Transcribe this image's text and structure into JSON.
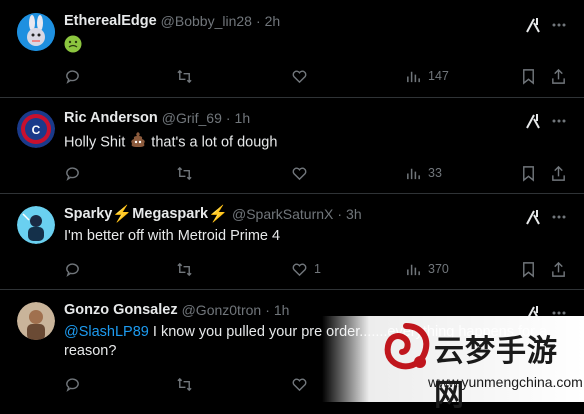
{
  "tweets": [
    {
      "name": "EtherealEdge",
      "handle": "@Bobby_lin28",
      "dot": "·",
      "time": "2h",
      "text": "",
      "emoji": "nauseated-face",
      "reply": "",
      "retweet": "",
      "like": "",
      "views": "147"
    },
    {
      "name": "Ric Anderson",
      "handle": "@Grif_69",
      "dot": "·",
      "time": "1h",
      "text_before": "Holly Shit ",
      "text_after": " that's a lot of dough",
      "emoji": "pile-of-poo",
      "reply": "",
      "retweet": "",
      "like": "",
      "views": "33"
    },
    {
      "name_part1": "Sparky ",
      "bolt": "⚡",
      "name_part2": "Megaspark",
      "handle": "@SparkSaturnX",
      "dot": "·",
      "time": "3h",
      "text": "I'm better off with Metroid Prime 4",
      "reply": "",
      "retweet": "",
      "like": "1",
      "views": "370"
    },
    {
      "name": "Gonzo Gonsalez",
      "handle": "@Gonz0tron",
      "dot": "·",
      "time": "1h",
      "mention": "@SlashLP89",
      "text": " I know you pulled your pre order.......everything happens for a reason?",
      "reply": "",
      "retweet": "",
      "like": "",
      "views": ""
    }
  ],
  "watermark": {
    "cn": "云梦手游网",
    "url": "www.yunmengchina.com"
  },
  "colors": {
    "background": "#000000",
    "text": "#e7e9ea",
    "muted": "#71767b",
    "link": "#1d9bf0",
    "divider": "#2f3336"
  }
}
